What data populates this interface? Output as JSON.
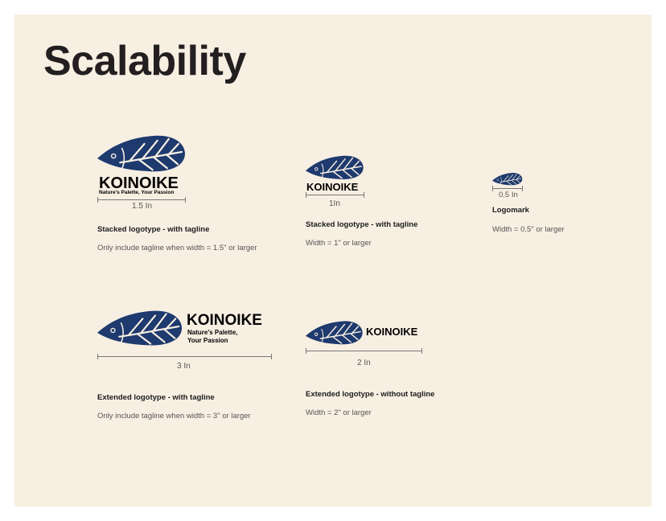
{
  "page": {
    "title": "Scalability"
  },
  "brand": {
    "name": "KOINOIKE",
    "tagline": "Nature's Palette, Your Passion",
    "tagline_line1": "Nature's Palette,",
    "tagline_line2": "Your Passion",
    "color": "#1e3a6e",
    "vein_color": "#f7efe2"
  },
  "variants": [
    {
      "measure": "1.5 In",
      "title": "Stacked logotype - with tagline",
      "note": "Only include tagline when width = 1.5\" or larger"
    },
    {
      "measure": "1In",
      "title": "Stacked logotype - with tagline",
      "note": "Width = 1\" or larger"
    },
    {
      "measure": "0.5 In",
      "title": "Logomark",
      "note": "Width = 0.5\" or larger"
    },
    {
      "measure": "3 In",
      "title": "Extended logotype - with tagline",
      "note": "Only include tagline when width = 3\" or larger"
    },
    {
      "measure": "2 In",
      "title": "Extended logotype - without tagline",
      "note": "Width = 2\" or larger"
    }
  ]
}
